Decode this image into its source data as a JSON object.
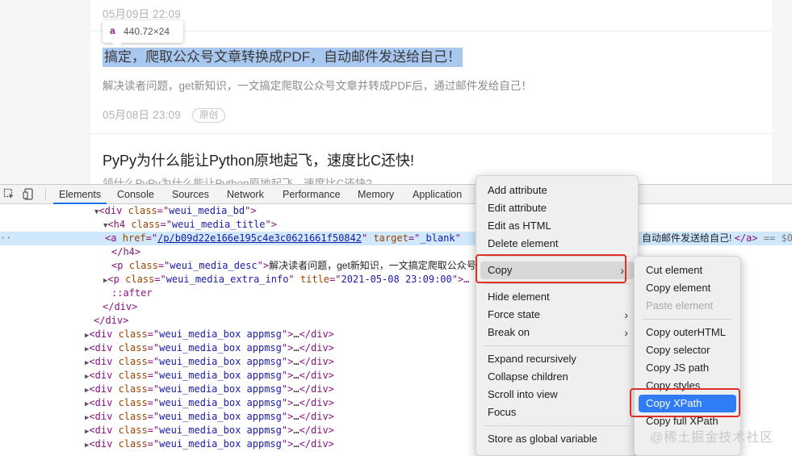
{
  "preview": {
    "date_top": "05月09日 22:09",
    "tooltip_tag": "a",
    "tooltip_dims": "440.72×24",
    "article1_title": "搞定，爬取公众号文章转换成PDF，自动邮件发送给自己！",
    "article1_desc": "解决读者问题，get新知识，一文搞定爬取公众号文章并转成PDF后，通过邮件发给自己！",
    "article1_date": "05月08日 23:09",
    "article1_badge": "原创",
    "article2_title": "PyPy为什么能让Python原地起飞，速度比C还快!",
    "article2_desc_cut": "领什么PyPy为什么能让Python原地起飞，速度比C还快?"
  },
  "devtools": {
    "tabs": [
      "Elements",
      "Console",
      "Sources",
      "Network",
      "Performance",
      "Memory",
      "Application"
    ],
    "active_tab": "Elements",
    "code": {
      "l0_tag": "div",
      "l0_attr": "class",
      "l0_val": "weui_media_bd",
      "l1_tag": "h4",
      "l1_attr": "class",
      "l1_val": "weui_media_title",
      "l2_tag": "a",
      "l2_href_attr": "href",
      "l2_href_val": "/p/b09d22e166e195c4e3c0621661f50842",
      "l2_target_attr": "target",
      "l2_target_val": "_blank",
      "l2_tail_text": "自动邮件发送给自己!",
      "l2_close": "</a>",
      "l2_eq": " == $0",
      "l3_close": "</h4>",
      "l4_tag": "p",
      "l4_attr": "class",
      "l4_val": "weui_media_desc",
      "l4_text": "解决读者问题，get新知识，一文搞定爬取公众号",
      "l5_tag": "p",
      "l5_attr1": "class",
      "l5_val1": "weui_media_extra_info",
      "l5_attr2": "title",
      "l5_val2": "2021-05-08 23:09:00",
      "l6_after": "::after",
      "l7_close": "</div>",
      "l8_close": "</div>",
      "box_tag": "div",
      "box_attr": "class",
      "box_val": "weui_media_box appmsg",
      "box_ellipsis": "…",
      "box_close": "</div>",
      "box_count": 9
    }
  },
  "context_menu": {
    "items": [
      "Add attribute",
      "Edit attribute",
      "Edit as HTML",
      "Delete element",
      "Copy",
      "Hide element",
      "Force state",
      "Break on",
      "Expand recursively",
      "Collapse children",
      "Scroll into view",
      "Focus",
      "Store as global variable"
    ]
  },
  "copy_submenu": {
    "items": [
      "Cut element",
      "Copy element",
      "Paste element",
      "Copy outerHTML",
      "Copy selector",
      "Copy JS path",
      "Copy styles",
      "Copy XPath",
      "Copy full XPath"
    ],
    "highlighted": "Copy XPath",
    "disabled": "Paste element"
  },
  "watermark": "@稀土掘金技术社区",
  "colors": {
    "accent": "#2f7cf6",
    "highlight_box": "#e0302a",
    "selection": "#a9c8f0"
  }
}
